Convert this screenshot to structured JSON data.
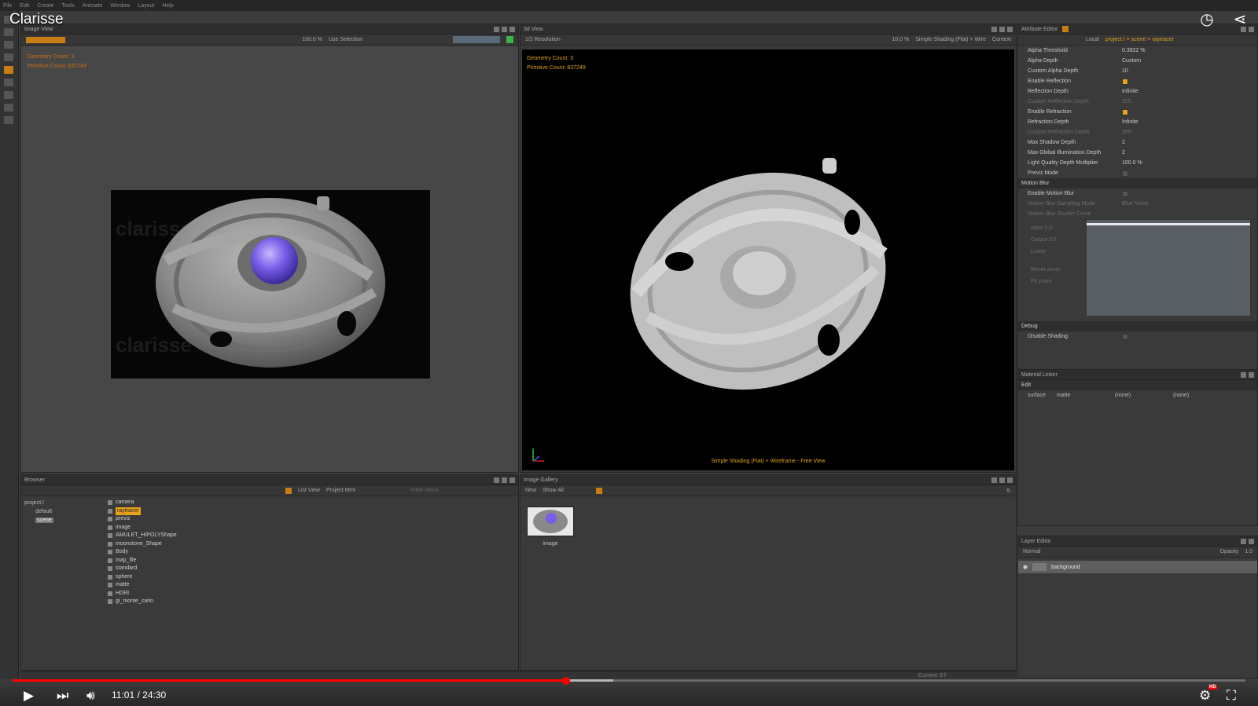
{
  "video": {
    "title": "Clarisse",
    "time": "11:01 / 24:30",
    "progress": 0.449,
    "hd_badge": "HD"
  },
  "menu": [
    "File",
    "Edit",
    "Create",
    "Tools",
    "Animate",
    "Window",
    "Layout",
    "Help"
  ],
  "image_view": {
    "title": "Image View",
    "zoom": "100.0 %",
    "mode": "Use Selection",
    "geometry_count": "Geometry Count: 3",
    "primitive_count": "Primitive Count: 837249"
  },
  "view3d": {
    "title": "3d View",
    "resolution": "1/2 Resolution",
    "zoom": "10.0 %",
    "shading_mode": "Simple Shading (Flat) + Wire",
    "context": "Context",
    "geometry_count": "Geometry Count: 3",
    "primitive_count": "Primitive Count: 837249",
    "caption": "Simple Shading (Flat) + Wireframe - Free View"
  },
  "attr_editor": {
    "title": "Attribute Editor",
    "space": "Local",
    "path": "project:/ > scene > raytracer",
    "rows": [
      {
        "label": "Alpha Threshold",
        "value": "0.3922 %",
        "dim": false,
        "check": null
      },
      {
        "label": "Alpha Depth",
        "value": "Custom",
        "dim": false,
        "check": null
      },
      {
        "label": "Custom Alpha Depth",
        "value": "10",
        "dim": false,
        "check": null
      },
      {
        "label": "Enable Reflection",
        "value": "",
        "dim": false,
        "check": true
      },
      {
        "label": "Reflection Depth",
        "value": "Infinite",
        "dim": false,
        "check": null
      },
      {
        "label": "Custom Reflection Depth",
        "value": "255",
        "dim": true,
        "check": null
      },
      {
        "label": "Enable Refraction",
        "value": "",
        "dim": false,
        "check": true
      },
      {
        "label": "Refraction Depth",
        "value": "Infinite",
        "dim": false,
        "check": null
      },
      {
        "label": "Custom Refraction Depth",
        "value": "255",
        "dim": true,
        "check": null
      },
      {
        "label": "Max Shadow Depth",
        "value": "2",
        "dim": false,
        "check": null
      },
      {
        "label": "Max Global Illumination Depth",
        "value": "2",
        "dim": false,
        "check": null
      },
      {
        "label": "Light Quality Depth Multiplier",
        "value": "100.0 %",
        "dim": false,
        "check": null
      },
      {
        "label": "Previz Mode",
        "value": "",
        "dim": false,
        "check": false
      }
    ],
    "motion_blur": {
      "section": "Motion Blur",
      "enable": "Enable Motion Blur",
      "sampling_mode_label": "Motion Blur Sampling Mode",
      "sampling_mode_value": "Blue Noise",
      "shutter_curve": "Motion Blur Shutter Curve",
      "input_label": "Input",
      "input_value": "0.0",
      "output_label": "Output",
      "output_value": "0.0",
      "interp": "Linear",
      "reset_zoom": "Reset zoom",
      "fit_zoom": "Fit zoom"
    },
    "debug": {
      "section": "Debug",
      "disable_shading": "Disable Shading"
    }
  },
  "material_linker": {
    "title": "Material Linker",
    "edit": "Edit",
    "surface": "surface",
    "material": "matte",
    "slot2": "(none)",
    "slot3": "(none)"
  },
  "layer_editor": {
    "title": "Layer Editor",
    "blend": "Normal",
    "opacity_label": "Opacity",
    "opacity_value": "1.0",
    "layer": "background"
  },
  "browser": {
    "title": "Browser",
    "view": "List View",
    "item_type": "Project Item",
    "filter_placeholder": "Filter Items",
    "tree": [
      "project:/",
      "default",
      "scene"
    ],
    "items": [
      "camera",
      "raytracer",
      "previz",
      "image",
      "AMULET_HIPOLYShape",
      "moonstone_Shape",
      "Body",
      "map_file",
      "standard",
      "sphere",
      "matte",
      "HDRI",
      "gi_monte_carlo"
    ],
    "selected": "raytracer"
  },
  "gallery": {
    "title": "Image Gallery",
    "new": "New",
    "show": "Show All",
    "thumb_label": "image"
  },
  "timeline": {
    "current_label": "Current: 0 f"
  },
  "colors": {
    "accent": "#e6a21a",
    "youtube_red": "#ff0000",
    "stats_orange": "#e0a020"
  }
}
